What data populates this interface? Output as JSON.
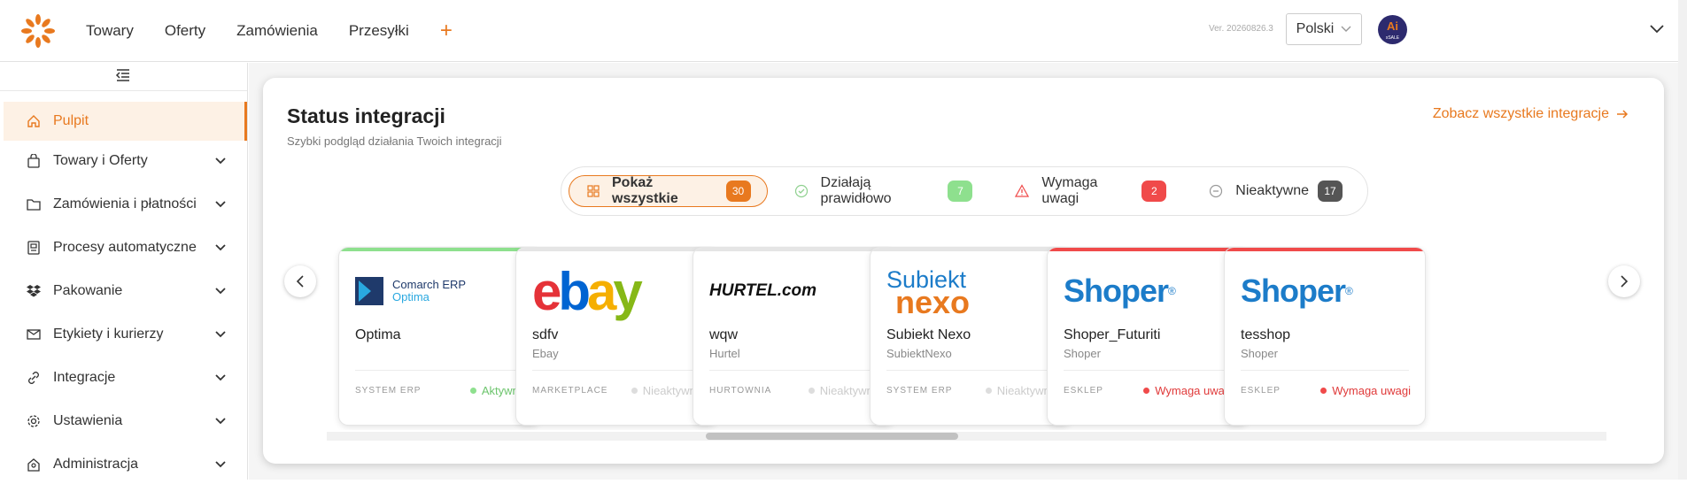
{
  "topbar": {
    "nav": [
      "Towary",
      "Oferty",
      "Zamówienia",
      "Przesyłki"
    ],
    "version": "Ver. 20260826.3",
    "language": "Polski",
    "avatar_top": "Ai",
    "avatar_bottom": "xSALE"
  },
  "sidebar": {
    "items": [
      {
        "label": "Pulpit",
        "icon": "home-icon"
      },
      {
        "label": "Towary i Oferty",
        "icon": "bag-icon"
      },
      {
        "label": "Zamówienia i płatności",
        "icon": "folder-icon"
      },
      {
        "label": "Procesy automatyczne",
        "icon": "process-icon"
      },
      {
        "label": "Pakowanie",
        "icon": "dropbox-icon"
      },
      {
        "label": "Etykiety i kurierzy",
        "icon": "mail-icon"
      },
      {
        "label": "Integracje",
        "icon": "link-icon"
      },
      {
        "label": "Ustawienia",
        "icon": "gear-icon"
      },
      {
        "label": "Administracja",
        "icon": "admin-icon"
      }
    ]
  },
  "main": {
    "title": "Status integracji",
    "subtitle": "Szybki podgląd działania Twoich integracji",
    "see_all": "Zobacz wszystkie integracje",
    "filters": [
      {
        "label": "Pokaż wszystkie",
        "count": "30"
      },
      {
        "label": "Działają prawidłowo",
        "count": "7"
      },
      {
        "label": "Wymaga uwagi",
        "count": "2"
      },
      {
        "label": "Nieaktywne",
        "count": "17"
      }
    ],
    "cards": [
      {
        "name": "Optima",
        "type": "",
        "category": "SYSTEM ERP",
        "status": "Aktywna",
        "logo_line1": "Comarch ERP",
        "logo_line2": "Optima"
      },
      {
        "name": "sdfv",
        "type": "Ebay",
        "category": "MARKETPLACE",
        "status": "Nieaktywna",
        "logo_text": "ebay"
      },
      {
        "name": "wqw",
        "type": "Hurtel",
        "category": "HURTOWNIA",
        "status": "Nieaktywna",
        "logo_text": "HURTEL.com"
      },
      {
        "name": "Subiekt Nexo",
        "type": "SubiektNexo",
        "category": "SYSTEM ERP",
        "status": "Nieaktywna",
        "logo_line1": "Subiekt",
        "logo_line2": "nexo"
      },
      {
        "name": "Shoper_Futuriti",
        "type": "Shoper",
        "category": "ESKLEP",
        "status": "Wymaga uwagi",
        "logo_text": "Shoper"
      },
      {
        "name": "tesshop",
        "type": "Shoper",
        "category": "ESKLEP",
        "status": "Wymaga uwagi",
        "logo_text": "Shoper"
      }
    ]
  },
  "colors": {
    "accent": "#e8791f",
    "ok": "#8ee08e",
    "warn": "#f04a4a",
    "inactive": "#555555"
  }
}
